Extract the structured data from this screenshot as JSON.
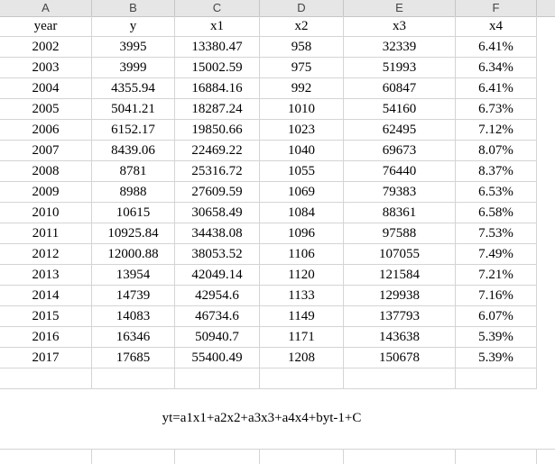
{
  "columns": [
    "A",
    "B",
    "C",
    "D",
    "E",
    "F"
  ],
  "headers": [
    "year",
    "y",
    "x1",
    "x2",
    "x3",
    "x4"
  ],
  "rows": [
    [
      "2002",
      "3995",
      "13380.47",
      "958",
      "32339",
      "6.41%"
    ],
    [
      "2003",
      "3999",
      "15002.59",
      "975",
      "51993",
      "6.34%"
    ],
    [
      "2004",
      "4355.94",
      "16884.16",
      "992",
      "60847",
      "6.41%"
    ],
    [
      "2005",
      "5041.21",
      "18287.24",
      "1010",
      "54160",
      "6.73%"
    ],
    [
      "2006",
      "6152.17",
      "19850.66",
      "1023",
      "62495",
      "7.12%"
    ],
    [
      "2007",
      "8439.06",
      "22469.22",
      "1040",
      "69673",
      "8.07%"
    ],
    [
      "2008",
      "8781",
      "25316.72",
      "1055",
      "76440",
      "8.37%"
    ],
    [
      "2009",
      "8988",
      "27609.59",
      "1069",
      "79383",
      "6.53%"
    ],
    [
      "2010",
      "10615",
      "30658.49",
      "1084",
      "88361",
      "6.58%"
    ],
    [
      "2011",
      "10925.84",
      "34438.08",
      "1096",
      "97588",
      "7.53%"
    ],
    [
      "2012",
      "12000.88",
      "38053.52",
      "1106",
      "107055",
      "7.49%"
    ],
    [
      "2013",
      "13954",
      "42049.14",
      "1120",
      "121584",
      "7.21%"
    ],
    [
      "2014",
      "14739",
      "42954.6",
      "1133",
      "129938",
      "7.16%"
    ],
    [
      "2015",
      "14083",
      "46734.6",
      "1149",
      "137793",
      "6.07%"
    ],
    [
      "2016",
      "16346",
      "50940.7",
      "1171",
      "143638",
      "5.39%"
    ],
    [
      "2017",
      "17685",
      "55400.49",
      "1208",
      "150678",
      "5.39%"
    ]
  ],
  "formula": "yt=a1x1+a2x2+a3x3+a4x4+byt-1+C"
}
